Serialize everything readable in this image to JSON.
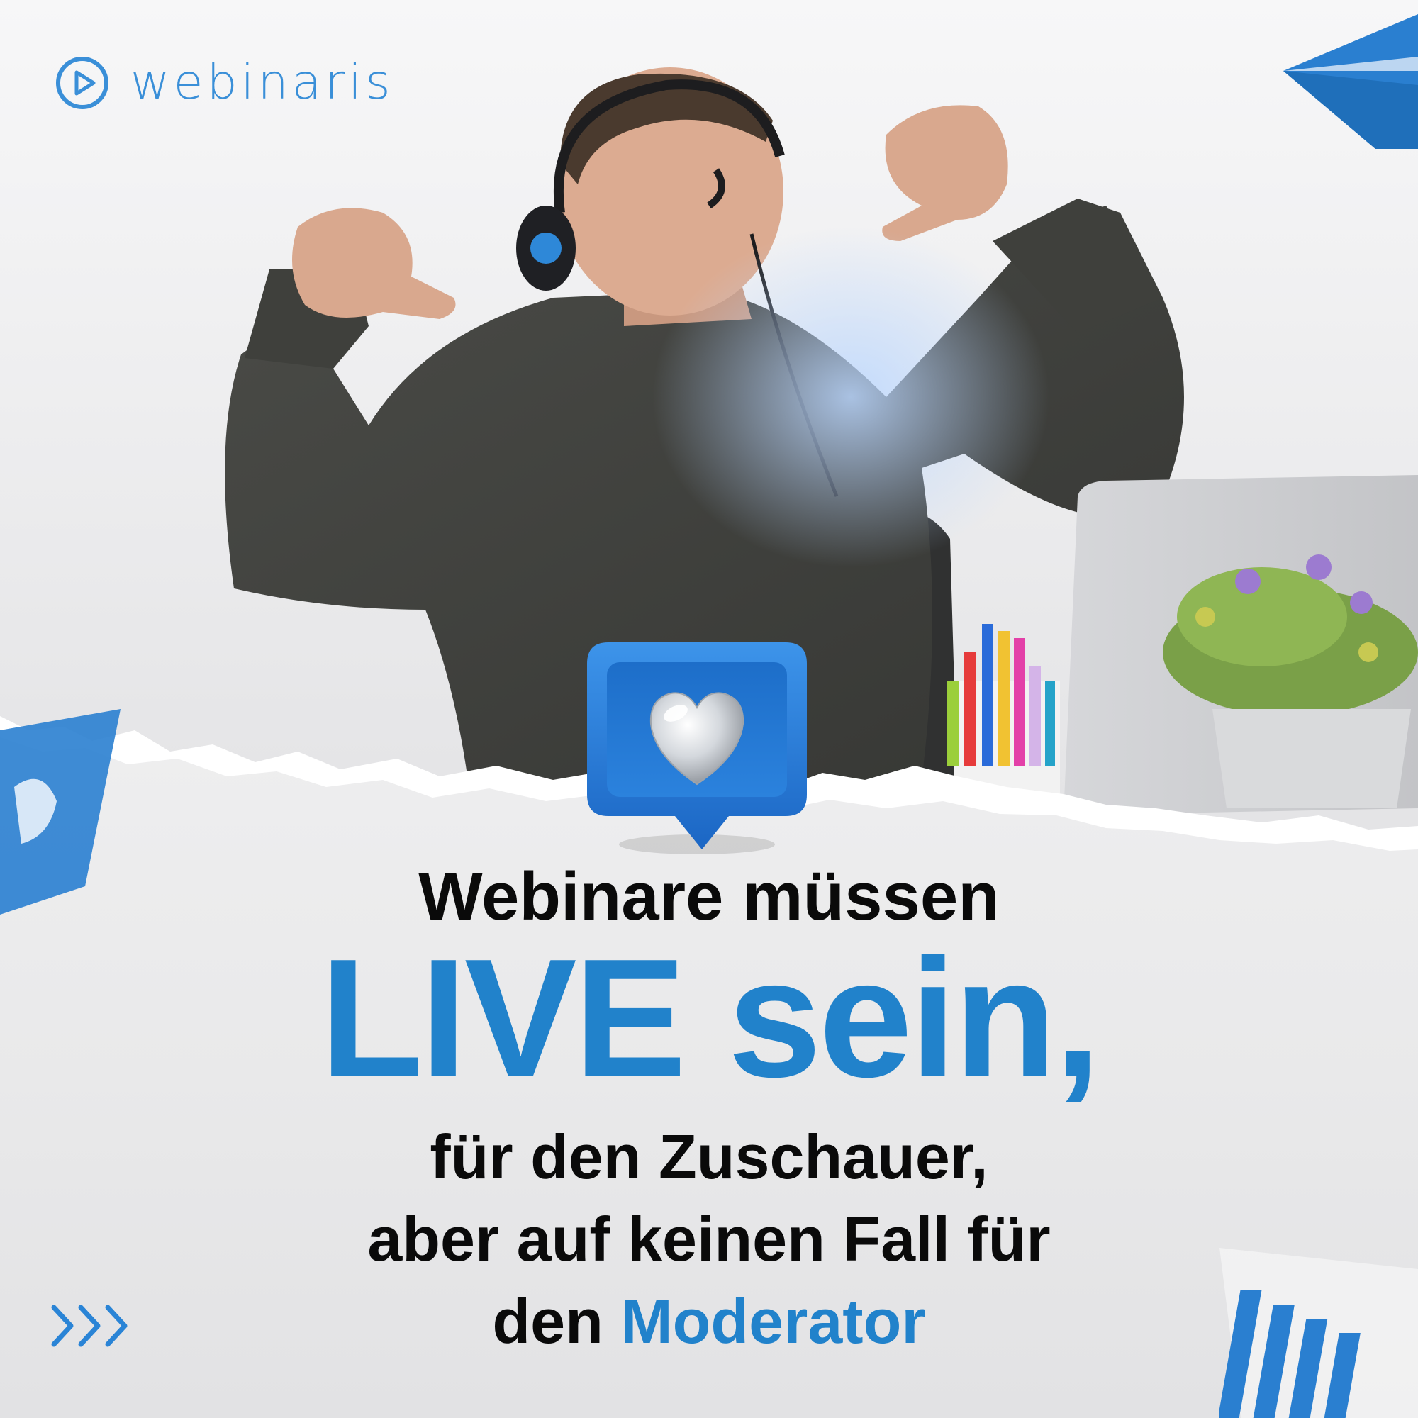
{
  "brand": {
    "name": "webinaris",
    "accent": "#2182cb"
  },
  "headline": {
    "line1": "Webinare müssen",
    "line2": "LIVE sein,",
    "line3": "für den Zuschauer,",
    "line4": "aber auf keinen Fall für",
    "line5_part1": "den ",
    "line5_part2": "Moderator"
  },
  "icons": {
    "logo": "play-circle-logo-icon",
    "badge": "heart-speech-bubble-icon",
    "chevrons": "triple-chevron-right-icon"
  },
  "colors": {
    "text": "#0a0a0a",
    "accent": "#2182cb",
    "background": "#ededee"
  }
}
